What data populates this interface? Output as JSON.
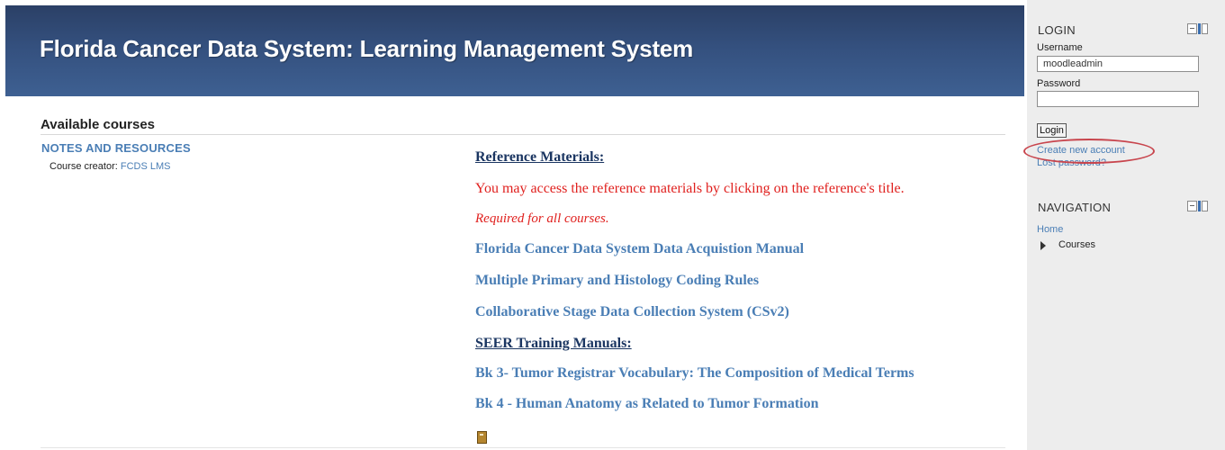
{
  "header": {
    "title": "Florida Cancer Data System: Learning Management System"
  },
  "main": {
    "available_heading": "Available courses",
    "course": {
      "name": "NOTES AND RESOURCES",
      "creator_label": "Course creator:",
      "creator_name": "FCDS LMS"
    },
    "summary": {
      "reference_heading": "Reference Materials:",
      "access_note": "You may access the reference materials by clicking on the reference's title.",
      "required_note": "Required for all courses.",
      "reference_links": [
        "Florida Cancer Data System Data Acquistion Manual",
        "Multiple Primary and Histology Coding Rules",
        "Collaborative Stage Data Collection System (CSv2)"
      ],
      "seer_heading": "SEER Training Manuals:",
      "seer_links": [
        "Bk 3- Tumor Registrar Vocabulary: The Composition of Medical Terms",
        "Bk 4 - Human Anatomy as Related to Tumor Formation"
      ],
      "file_icon": "file-icon"
    }
  },
  "sidebar": {
    "login": {
      "title": "LOGIN",
      "username_label": "Username",
      "username_value": "moodleadmin",
      "password_label": "Password",
      "password_value": "",
      "login_button": "Login",
      "create_account": "Create new account",
      "lost_password": "Lost password?"
    },
    "navigation": {
      "title": "NAVIGATION",
      "home": "Home",
      "courses": "Courses"
    }
  },
  "colors": {
    "header_bg": "#34507e",
    "link_blue": "#4a7eb5",
    "alert_red": "#e0201e",
    "highlight_ellipse": "#c8454d",
    "sidebar_bg": "#ededed"
  }
}
